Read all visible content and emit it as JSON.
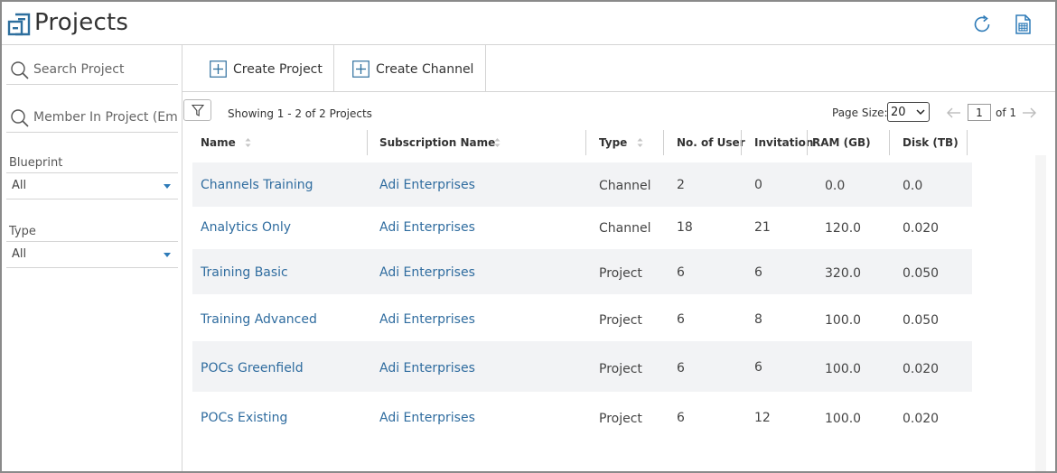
{
  "header": {
    "title": "Projects",
    "logo_icon": "projects-logo-icon",
    "refresh_icon": "refresh-icon",
    "export_icon": "spreadsheet-export-icon"
  },
  "sidebar": {
    "search_project_placeholder": "Search Project",
    "member_search_placeholder": "Member In Project (Email)",
    "blueprint_label": "Blueprint",
    "blueprint_value": "All",
    "type_label": "Type",
    "type_value": "All"
  },
  "toolbar": {
    "create_project_label": "Create Project",
    "create_channel_label": "Create Channel"
  },
  "grid": {
    "showing_text": "Showing 1 - 2 of 2 Projects",
    "page_size_label": "Page Size:",
    "page_size_value": "20",
    "current_page": "1",
    "of_pages": "of 1"
  },
  "table": {
    "columns": [
      "Name",
      "Subscription Name",
      "Type",
      "No. of User",
      "Invitation",
      "RAM (GB)",
      "Disk (TB)"
    ],
    "rows": [
      {
        "name": "Channels Training",
        "subscription": "Adi Enterprises",
        "type": "Channel",
        "users": "2",
        "invitation": "0",
        "ram": "0.0",
        "disk": "0.0"
      },
      {
        "name": "Analytics Only",
        "subscription": "Adi Enterprises",
        "type": "Channel",
        "users": "18",
        "invitation": "21",
        "ram": "120.0",
        "disk": "0.020"
      },
      {
        "name": "Training Basic",
        "subscription": "Adi Enterprises",
        "type": "Project",
        "users": "6",
        "invitation": "6",
        "ram": "320.0",
        "disk": "0.050"
      },
      {
        "name": "Training Advanced",
        "subscription": "Adi Enterprises",
        "type": "Project",
        "users": "6",
        "invitation": "8",
        "ram": "100.0",
        "disk": "0.050"
      },
      {
        "name": "POCs Greenfield",
        "subscription": "Adi Enterprises",
        "type": "Project",
        "users": "6",
        "invitation": "6",
        "ram": "100.0",
        "disk": "0.020"
      },
      {
        "name": "POCs Existing",
        "subscription": "Adi Enterprises",
        "type": "Project",
        "users": "6",
        "invitation": "12",
        "ram": "100.0",
        "disk": "0.020"
      }
    ]
  },
  "colors": {
    "accent": "#2e7bb8",
    "link": "#2f6c9f",
    "row_alt": "#f2f3f5",
    "border": "#d4d4d4"
  }
}
